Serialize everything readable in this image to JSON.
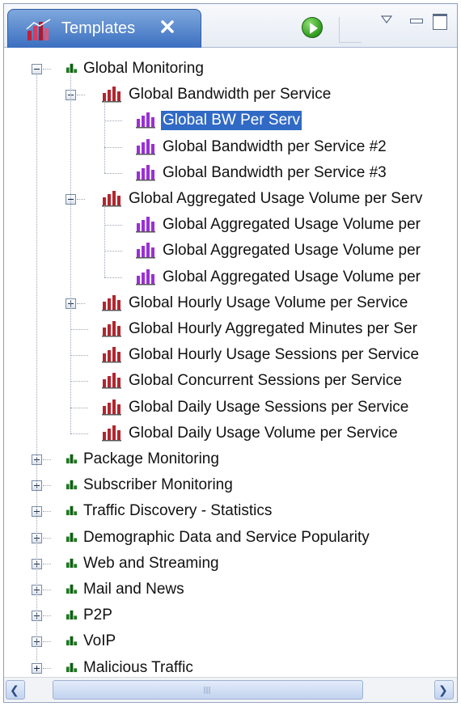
{
  "header": {
    "tab_title": "Templates",
    "tab_icon": "chart-folder-icon",
    "close_icon": "close-icon",
    "run_icon": "run-play-icon",
    "view_menu_icon": "chevron-down-icon",
    "minimize_icon": "minimize-icon",
    "maximize_icon": "maximize-icon"
  },
  "tree": {
    "selected": "Global BW Per Serv",
    "groups": [
      {
        "label": "Global Monitoring",
        "expanded": true,
        "icon": "group-chart-icon",
        "children": [
          {
            "label": "Global Bandwidth per Service",
            "expanded": true,
            "icon": "template-chart-icon",
            "children": [
              {
                "label": "Global BW Per Serv",
                "icon": "report-chart-icon"
              },
              {
                "label": "Global Bandwidth per Service #2",
                "icon": "report-chart-icon"
              },
              {
                "label": "Global Bandwidth per Service #3",
                "icon": "report-chart-icon"
              }
            ]
          },
          {
            "label": "Global Aggregated Usage Volume per Serv",
            "expanded": true,
            "icon": "template-chart-icon",
            "children": [
              {
                "label": "Global Aggregated Usage Volume per",
                "icon": "report-chart-icon"
              },
              {
                "label": "Global Aggregated Usage Volume per",
                "icon": "report-chart-icon"
              },
              {
                "label": "Global Aggregated Usage Volume per",
                "icon": "report-chart-icon"
              }
            ]
          },
          {
            "label": "Global Hourly Usage Volume per Service",
            "expanded": false,
            "icon": "template-chart-icon"
          },
          {
            "label": "Global Hourly Aggregated Minutes per Ser",
            "icon": "template-chart-icon"
          },
          {
            "label": "Global Hourly Usage Sessions per Service",
            "icon": "template-chart-icon"
          },
          {
            "label": "Global Concurrent Sessions per Service",
            "icon": "template-chart-icon"
          },
          {
            "label": "Global Daily Usage Sessions per Service",
            "icon": "template-chart-icon"
          },
          {
            "label": "Global Daily Usage Volume per Service",
            "icon": "template-chart-icon"
          }
        ]
      },
      {
        "label": "Package Monitoring",
        "expanded": false,
        "icon": "group-chart-icon"
      },
      {
        "label": "Subscriber Monitoring",
        "expanded": false,
        "icon": "group-chart-icon"
      },
      {
        "label": "Traffic Discovery - Statistics",
        "expanded": false,
        "icon": "group-chart-icon"
      },
      {
        "label": "Demographic Data and Service Popularity",
        "expanded": false,
        "icon": "group-chart-icon"
      },
      {
        "label": "Web and Streaming",
        "expanded": false,
        "icon": "group-chart-icon"
      },
      {
        "label": "Mail and News",
        "expanded": false,
        "icon": "group-chart-icon"
      },
      {
        "label": "P2P",
        "expanded": false,
        "icon": "group-chart-icon"
      },
      {
        "label": "VoIP",
        "expanded": false,
        "icon": "group-chart-icon"
      },
      {
        "label": "Malicious Traffic",
        "expanded": false,
        "icon": "group-chart-icon"
      }
    ]
  },
  "scrollbar": {
    "left_icon": "scroll-left-icon",
    "right_icon": "scroll-right-icon",
    "grip_icon": "grip-icon",
    "left_glyph": "❮",
    "right_glyph": "❯"
  },
  "colors": {
    "selection": "#316ac5",
    "tab_gradient_top": "#7fa8dd",
    "tab_gradient_bottom": "#3b6fc0",
    "group_icon": "#1f7a1f",
    "template_icon": "#b3262f",
    "report_icon": "#9b2fd6"
  }
}
